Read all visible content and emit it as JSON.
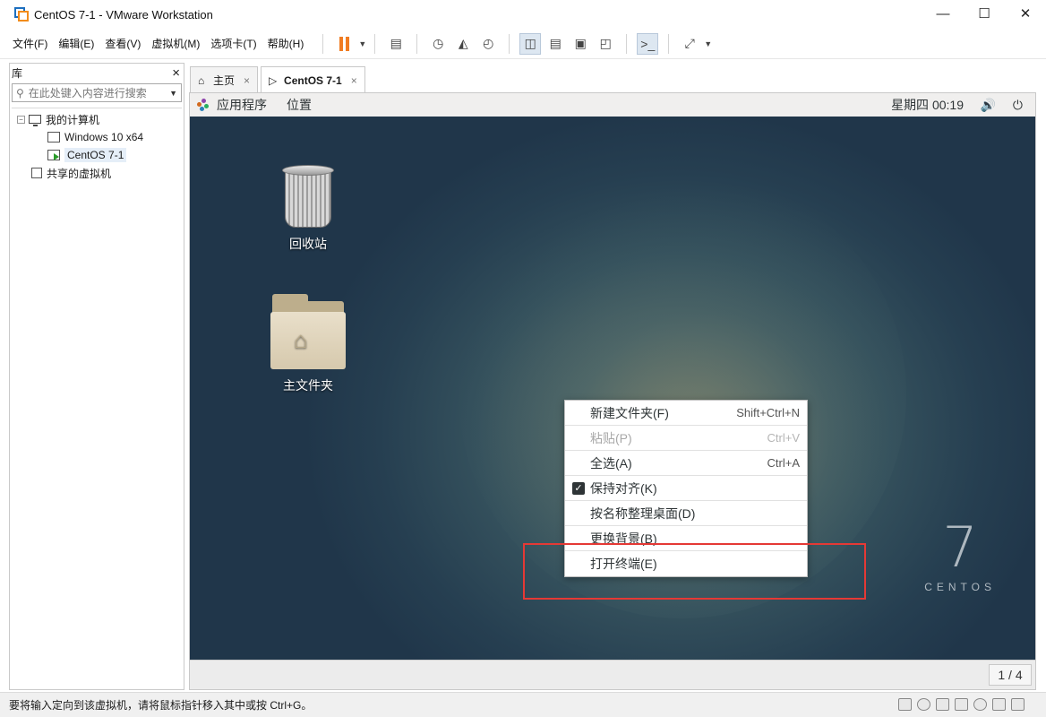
{
  "window": {
    "title": "CentOS 7-1 - VMware Workstation"
  },
  "menubar": {
    "items": [
      "文件(F)",
      "编辑(E)",
      "查看(V)",
      "虚拟机(M)",
      "选项卡(T)",
      "帮助(H)"
    ]
  },
  "library": {
    "title": "库",
    "close": "×",
    "search_placeholder": "在此处键入内容进行搜索",
    "tree": {
      "my_computer": "我的计算机",
      "vms": [
        "Windows 10 x64",
        "CentOS 7-1"
      ],
      "shared": "共享的虚拟机"
    }
  },
  "tabs": [
    {
      "label": "主页",
      "close": "×"
    },
    {
      "label": "CentOS 7-1",
      "close": "×"
    }
  ],
  "gnome": {
    "apps": "应用程序",
    "places": "位置",
    "clock": "星期四 00:19",
    "volume_icon": "🔊",
    "power_icon": "⏻"
  },
  "desktop": {
    "icons": [
      {
        "label": "回收站",
        "icon": "trash-icon"
      },
      {
        "label": "主文件夹",
        "icon": "home-folder-icon"
      }
    ],
    "brand_number": "7",
    "brand_word": "CENTOS",
    "workspace": "1 / 4"
  },
  "context_menu": {
    "items": [
      {
        "label": "新建文件夹(F)",
        "shortcut": "Shift+Ctrl+N",
        "enabled": true
      },
      {
        "label": "粘贴(P)",
        "shortcut": "Ctrl+V",
        "enabled": false
      },
      {
        "label": "全选(A)",
        "shortcut": "Ctrl+A",
        "enabled": true
      },
      {
        "label": "保持对齐(K)",
        "shortcut": "",
        "enabled": true,
        "checked": true
      },
      {
        "label": "按名称整理桌面(D)",
        "shortcut": "",
        "enabled": true
      },
      {
        "label": "更换背景(B)",
        "shortcut": "",
        "enabled": true
      },
      {
        "label": "打开终端(E)",
        "shortcut": "",
        "enabled": true
      }
    ]
  },
  "status": {
    "text": "要将输入定向到该虚拟机，请将鼠标指针移入其中或按 Ctrl+G。"
  },
  "colors": {
    "pause_accent": "#f07c22",
    "highlight": "#e53935"
  }
}
